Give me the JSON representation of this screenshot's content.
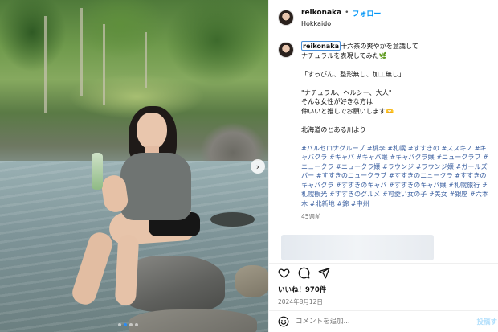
{
  "header": {
    "username": "reikonaka",
    "separator": "•",
    "follow_label": "フォロー",
    "location": "Hokkaido"
  },
  "caption": {
    "username": "reikonaka",
    "lines": [
      "十六茶の爽やかを意識して",
      "ナチュラルを表現してみた🌿",
      "",
      "「すっぴん、整形無し、加工無し」",
      "",
      "\"ナチュラル、ヘルシー、大人\"",
      "そんな女性が好きな方は",
      "仲いいと推しでお願いします🫶",
      "",
      "北海道のとある川より",
      ""
    ],
    "hashtags": "#バルセロナグループ #桃李 #札幌 #すすきの #ススキノ #キャバクラ #キャバ #キャバ嬢 #キャバクラ嬢 #ニュークラブ #ニュークラ #ニュークラ嬢 #ラウンジ #ラウンジ嬢 #ガールズバー #すすきのニュークラブ #すすきのニュークラ #すすきのキャバクラ #すすきのキャバ #すすきのキャバ嬢 #札幌旅行 #札幌観光 #すすきのグルメ #可愛い女の子 #美女 #銀座 #六本木 #北新地 #錦 #中州",
    "time_ago": "45週前"
  },
  "actions": {
    "like_icon": "heart-icon",
    "comment_icon": "comment-icon",
    "share_icon": "share-icon",
    "likes": "いいね！970件",
    "date": "2024年8月12日"
  },
  "comment": {
    "placeholder": "コメントを追加...",
    "post_label": "投稿す"
  },
  "carousel": {
    "next_icon": "chevron-right-icon",
    "slide_count": 4,
    "active_index": 1
  },
  "colors": {
    "accent": "#0095f6",
    "hashtag": "#3a5fa0",
    "muted": "#737373"
  }
}
